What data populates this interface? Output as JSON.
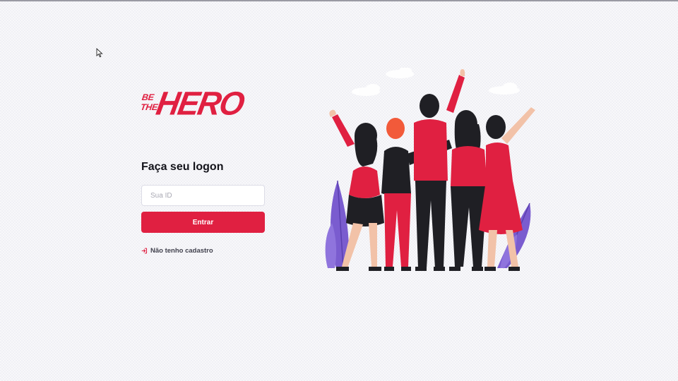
{
  "brand": {
    "logo_small_line1": "BE",
    "logo_small_line2": "THE",
    "logo_big": "HERO",
    "color": "#e02041"
  },
  "logon": {
    "title": "Faça seu logon",
    "id_placeholder": "Sua ID",
    "id_value": "",
    "enter_label": "Entrar",
    "register_label": "Não tenho cadastro",
    "register_icon": "log-in-icon"
  },
  "illustration": {
    "name": "heroes-group",
    "colors": [
      "#e02041",
      "#1f1f24",
      "#7a5ccf"
    ]
  }
}
